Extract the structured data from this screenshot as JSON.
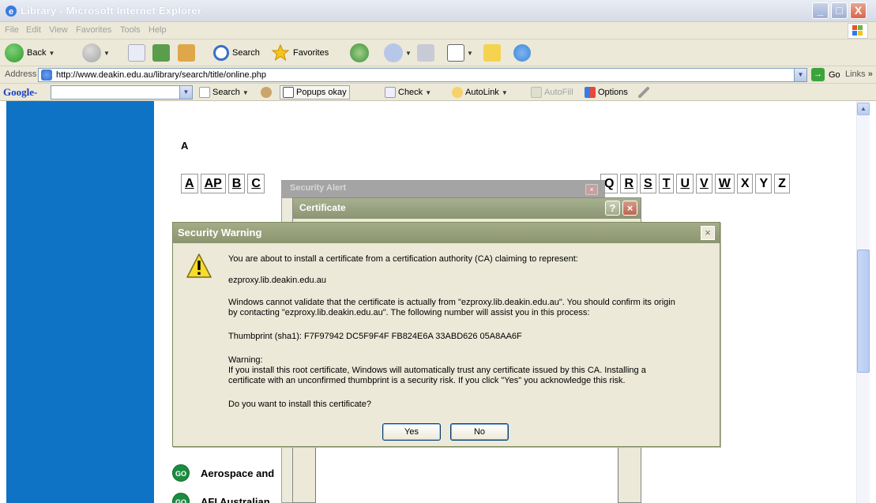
{
  "window": {
    "title": "Library - Microsoft Internet Explorer",
    "min_glyph": "_",
    "max_glyph": "□",
    "close_glyph": "X"
  },
  "menu": [
    "File",
    "Edit",
    "View",
    "Favorites",
    "Tools",
    "Help"
  ],
  "toolbar": {
    "back_label": "Back",
    "search_label": "Search",
    "favorites_label": "Favorites"
  },
  "address": {
    "label": "Address",
    "url": "http://www.deakin.edu.au/library/search/title/online.php",
    "go_label": "Go",
    "links_label": "Links",
    "links_chevron": "»"
  },
  "google_toolbar": {
    "logo": "Google",
    "logo_suffix": "-",
    "search_label": "Search",
    "popups_label": "Popups okay",
    "check_label": "Check",
    "autolink_label": "AutoLink",
    "autofill_label": "AutoFill",
    "options_label": "Options"
  },
  "page": {
    "heading": "A",
    "az_left": [
      "A",
      "AP",
      "B",
      "C"
    ],
    "az_right": [
      "Q",
      "R",
      "S",
      "T",
      "U",
      "V",
      "W",
      "X",
      "Y",
      "Z"
    ],
    "az_right_underlined": [
      "R",
      "S",
      "T",
      "U",
      "V",
      "W"
    ],
    "go_badge": "GO",
    "rows": [
      {
        "text": "Aerospace and"
      },
      {
        "text": "AFI Australian"
      }
    ]
  },
  "dialogs": {
    "security_alert_title": "Security Alert",
    "certificate_title": "Certificate",
    "certificate_help": "?",
    "warning": {
      "title": "Security Warning",
      "close_glyph": "×",
      "line1": "You are about to install a certificate from a certification authority (CA) claiming to represent:",
      "line2": "ezproxy.lib.deakin.edu.au",
      "line3": "Windows cannot validate that the certificate is actually from \"ezproxy.lib.deakin.edu.au\". You should confirm its origin",
      "line4": "by contacting \"ezproxy.lib.deakin.edu.au\". The following number will assist you in this process:",
      "line5": "Thumbprint (sha1): F7F97942 DC5F9F4F FB824E6A 33ABD626 05A8AA6F",
      "line6": "Warning:",
      "line7": "If you install this root certificate, Windows will automatically trust any certificate issued by this CA. Installing a",
      "line8": "certificate with an unconfirmed thumbprint is a security risk. If you click \"Yes\" you acknowledge this risk.",
      "line9": "Do you want to install this certificate?",
      "yes_label": "Yes",
      "no_label": "No"
    }
  },
  "colors": {
    "left_band": "#0e73c5",
    "dialog_titlebar": "#8b9570",
    "go_badge": "#1b8c40"
  }
}
